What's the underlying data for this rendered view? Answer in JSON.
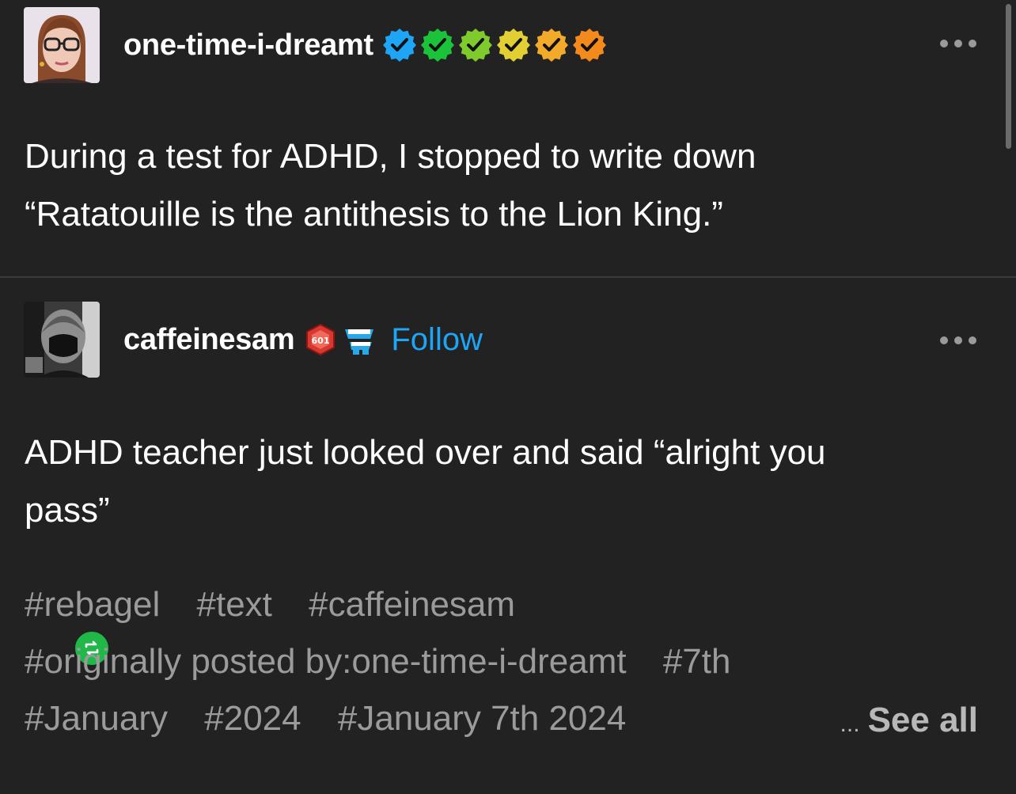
{
  "post1": {
    "username": "one-time-i-dreamt",
    "badges": [
      {
        "icon": "verified-check-badge-icon",
        "color": "#1ea5f5"
      },
      {
        "icon": "verified-check-badge-icon",
        "color": "#1bc33b"
      },
      {
        "icon": "verified-check-badge-icon",
        "color": "#7fca2c"
      },
      {
        "icon": "verified-check-badge-icon",
        "color": "#e2cf34"
      },
      {
        "icon": "verified-check-badge-icon",
        "color": "#f2aa2a"
      },
      {
        "icon": "verified-check-badge-icon",
        "color": "#f28a1c"
      }
    ],
    "text_line1": "During a test for ADHD, I stopped to write down",
    "text_line2": "“Ratatouille is the antithesis to the Lion King.”"
  },
  "post2": {
    "username": "caffeinesam",
    "badge_number": "601",
    "follow_label": "Follow",
    "text_line1": "ADHD teacher just looked over and said “alright you",
    "text_line2": "pass”",
    "tags": [
      "#rebagel",
      "#text",
      "#caffeinesam",
      "#originally posted by:one-time-i-dreamt",
      "#7th",
      "#January",
      "#2024",
      "#January 7th 2024"
    ],
    "see_all_ellipsis": "...",
    "see_all_label": "See all"
  },
  "colors": {
    "background": "#222222",
    "accent": "#1ea5f5",
    "reblog": "#21b84a",
    "tag_text": "#9b9b9b"
  }
}
